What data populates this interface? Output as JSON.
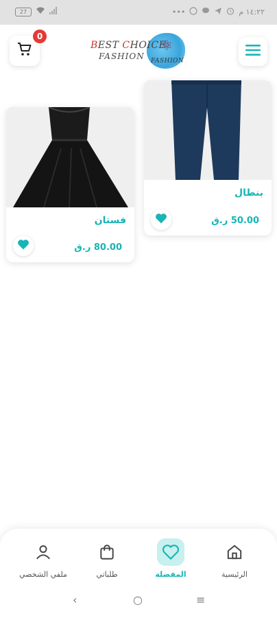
{
  "status_bar": {
    "battery": "27",
    "time": "١٤:٢٢ م",
    "more": "•••"
  },
  "header": {
    "cart_count": "0",
    "logo_line1_a": "B",
    "logo_line1_b": "EST ",
    "logo_line1_c": "C",
    "logo_line1_d": "HOICE",
    "logo_line2": "FASHION",
    "logo_badge_text": "FASHION"
  },
  "products": [
    {
      "name": "بنطال",
      "price": "50.00 ر.ق",
      "image": "navy-trousers"
    },
    {
      "name": "فستان",
      "price": "80.00 ر.ق",
      "image": "black-lace-dress"
    }
  ],
  "bottom_nav": {
    "items": [
      {
        "label": "ملفي الشخصي",
        "icon": "user-icon"
      },
      {
        "label": "طلباتي",
        "icon": "bag-icon"
      },
      {
        "label": "المفضلة",
        "icon": "heart-icon",
        "active": true
      },
      {
        "label": "الرئيسية",
        "icon": "home-icon"
      }
    ]
  },
  "system_nav": {
    "back": "‹",
    "home": "○",
    "recents": "≡"
  },
  "colors": {
    "accent": "#17b5b5",
    "badge": "#e53935",
    "active_bg": "#c7f0ee"
  }
}
